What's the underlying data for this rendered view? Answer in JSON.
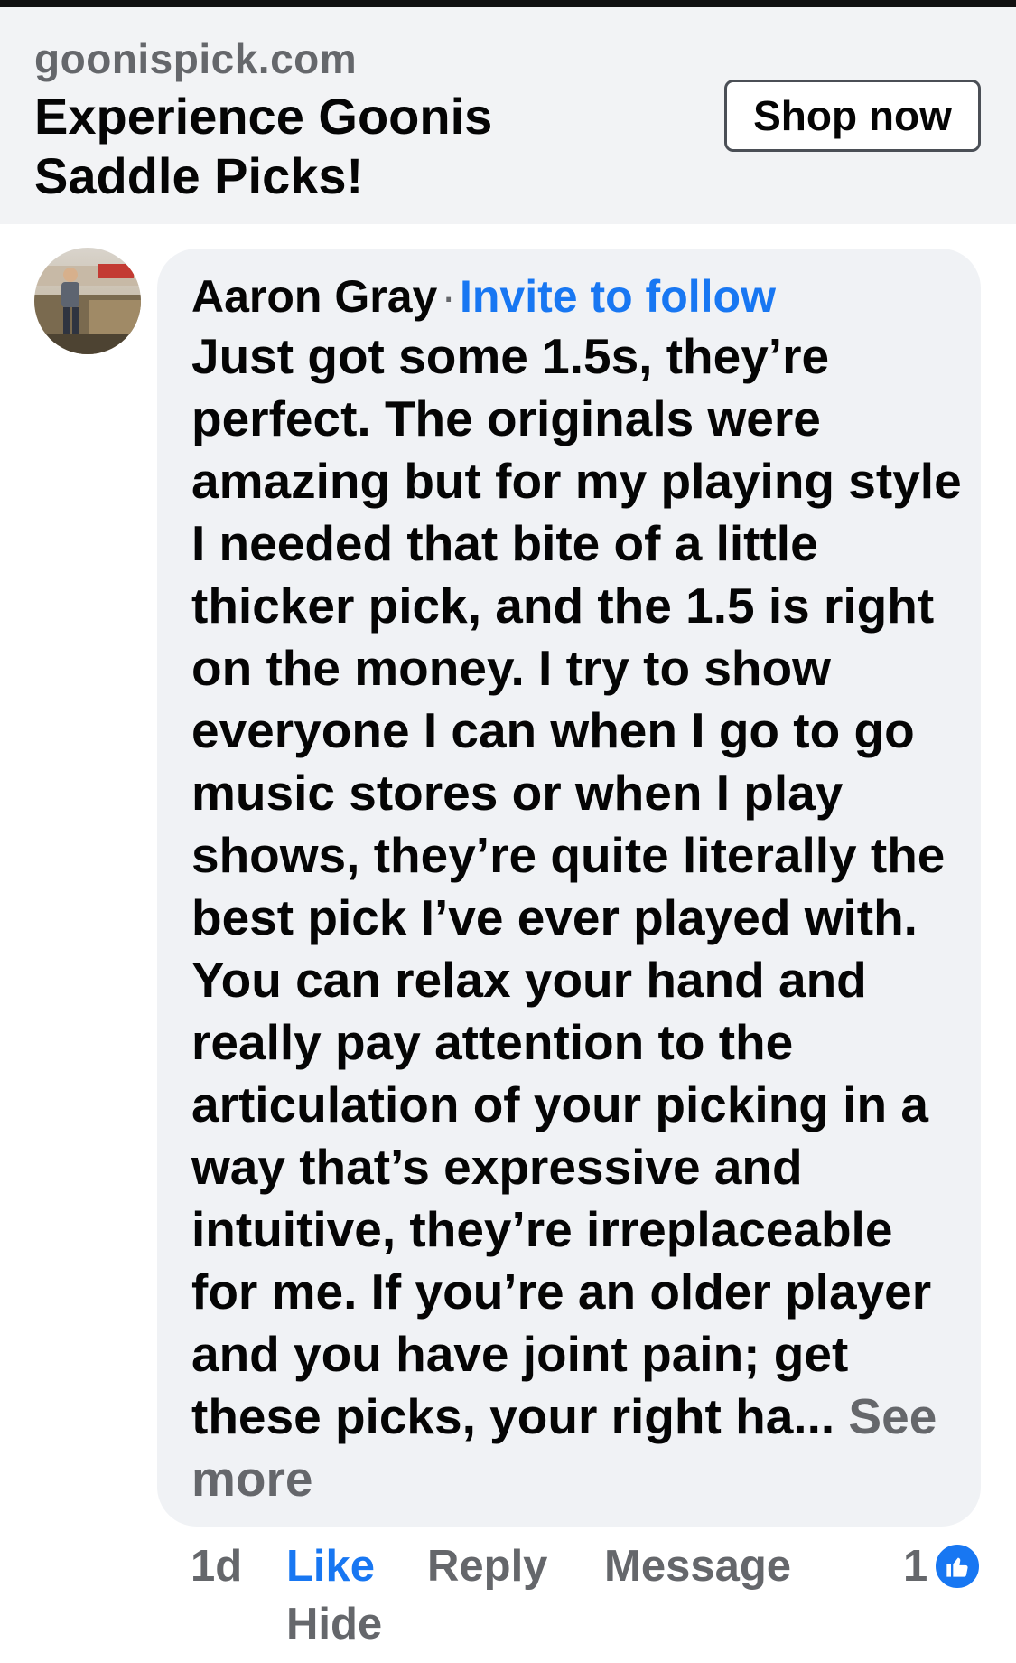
{
  "ad": {
    "domain": "goonispick.com",
    "title": "Experience Goonis Saddle Picks!",
    "cta_label": "Shop now"
  },
  "comment": {
    "author": "Aaron Gray",
    "separator": "·",
    "invite_label": "Invite to follow",
    "text": "Just got some 1.5s, they’re perfect. The originals were amazing but for my playing style I needed that bite of a little thicker pick, and the 1.5 is right on the money. I try to show everyone I can when I go to go music stores or when I play shows, they’re quite literally the best pick I’ve ever played with. You can relax your hand and really pay attention to the articulation of your picking in a way that’s expressive and intuitive, they’re irreplaceable for me. If you’re an older player and you have joint pain; get these picks, your right ha...",
    "see_more_label": "See more"
  },
  "actions": {
    "time": "1d",
    "like_label": "Like",
    "reply_label": "Reply",
    "message_label": "Message",
    "hide_label": "Hide",
    "reaction_count": "1"
  },
  "colors": {
    "link_blue": "#1877f2",
    "muted_gray": "#65676b",
    "bubble_bg": "#f0f2f5"
  },
  "icons": {
    "reaction": "thumbs-up-icon",
    "avatar": "user-avatar"
  }
}
